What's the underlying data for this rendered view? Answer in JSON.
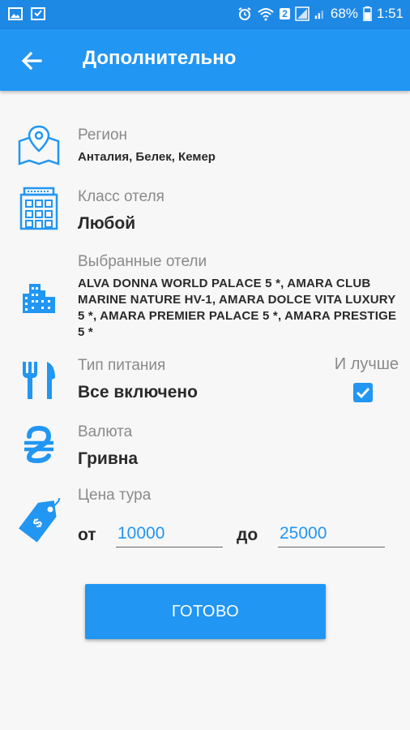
{
  "status_bar": {
    "battery": "68%",
    "time": "1:51",
    "sim": "2"
  },
  "app_bar": {
    "title": "Дополнительно"
  },
  "region": {
    "label": "Регион",
    "value": "Анталия, Белек, Кемер"
  },
  "hotel_class": {
    "label": "Класс отеля",
    "value": "Любой"
  },
  "selected_hotels": {
    "label": "Выбранные отели",
    "value": "ALVA DONNA WORLD PALACE 5 *, AMARA CLUB MARINE NATURE HV-1, AMARA DOLCE VITA LUXURY 5 *, AMARA PREMIER PALACE 5 *, AMARA PRESTIGE 5 *"
  },
  "meal_type": {
    "label": "Тип питания",
    "value": "Все включено",
    "better_label": "И лучше",
    "better_checked": true
  },
  "currency": {
    "label": "Валюта",
    "value": "Гривна"
  },
  "price": {
    "label": "Цена тура",
    "from_label": "от",
    "from_value": "10000",
    "to_label": "до",
    "to_value": "25000"
  },
  "done_button": {
    "label": "ГОТОВО"
  },
  "colors": {
    "primary": "#2196f3",
    "status_bar": "#1e88e5",
    "label_gray": "#8a8a8a",
    "value_dark": "#2a2a2a"
  }
}
